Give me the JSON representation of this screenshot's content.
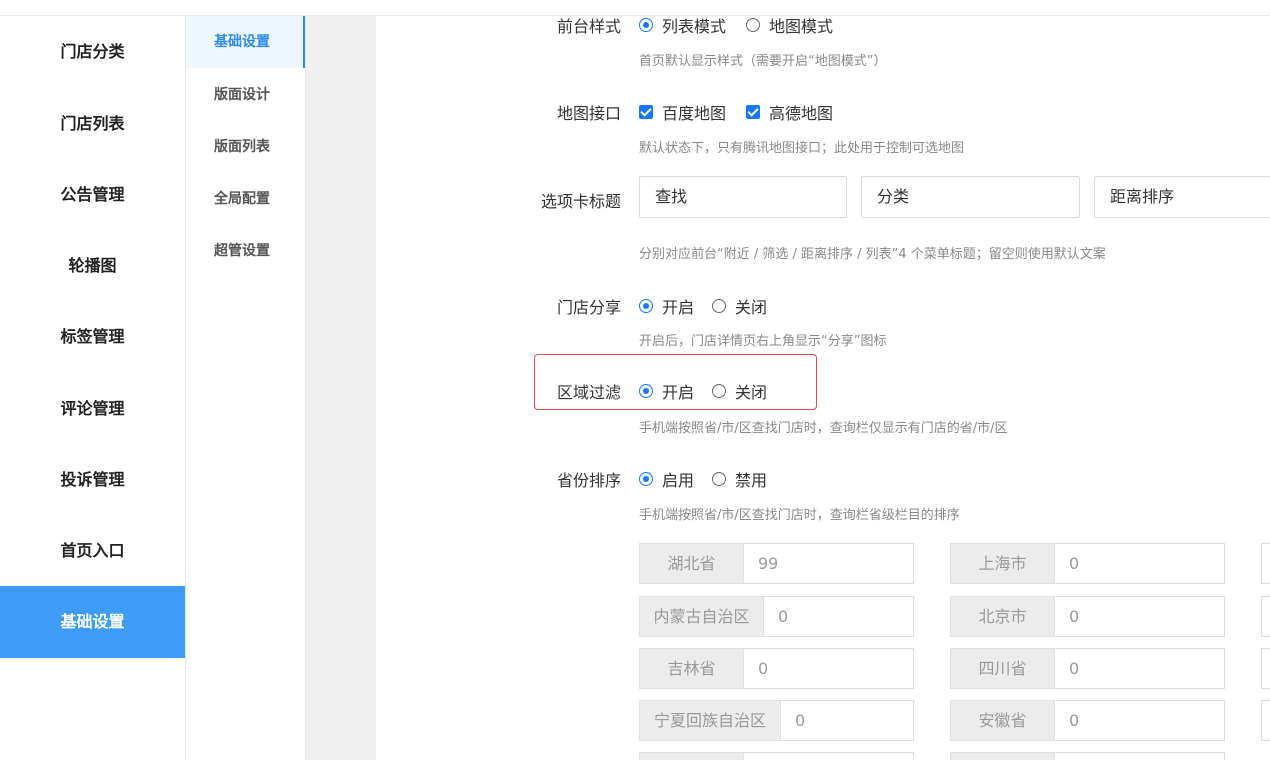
{
  "sidebar": {
    "items": [
      {
        "label": "门店分类"
      },
      {
        "label": "门店列表"
      },
      {
        "label": "公告管理"
      },
      {
        "label": "轮播图"
      },
      {
        "label": "标签管理"
      },
      {
        "label": "评论管理"
      },
      {
        "label": "投诉管理"
      },
      {
        "label": "首页入口"
      },
      {
        "label": "基础设置",
        "active": true
      }
    ],
    "active_color": "#3c9cf7"
  },
  "subnav": {
    "items": [
      {
        "label": "基础设置",
        "active": true
      },
      {
        "label": "版面设计"
      },
      {
        "label": "版面列表"
      },
      {
        "label": "全局配置"
      },
      {
        "label": "超管设置"
      }
    ]
  },
  "form": {
    "style": {
      "label": "前台样式",
      "options": [
        {
          "label": "列表模式",
          "checked": true
        },
        {
          "label": "地图模式",
          "checked": false
        }
      ],
      "hint": "首页默认显示样式（需要开启“地图模式”）"
    },
    "map": {
      "label": "地图接口",
      "options": [
        {
          "label": "百度地图",
          "checked": true
        },
        {
          "label": "高德地图",
          "checked": true
        }
      ],
      "hint": "默认状态下，只有腾讯地图接口；此处用于控制可选地图"
    },
    "tabs": {
      "label": "选项卡标题",
      "values": [
        "查找",
        "分类",
        "距离排序"
      ],
      "hint": "分别对应前台“附近 / 筛选 / 距离排序 / 列表”4 个菜单标题；留空则使用默认文案"
    },
    "share": {
      "label": "门店分享",
      "options": [
        {
          "label": "开启",
          "checked": true
        },
        {
          "label": "关闭",
          "checked": false
        }
      ],
      "hint": "开启后，门店详情页右上角显示“分享”图标"
    },
    "region_filter": {
      "label": "区域过滤",
      "options": [
        {
          "label": "开启",
          "checked": true
        },
        {
          "label": "关闭",
          "checked": false
        }
      ],
      "hint": "手机端按照省/市/区查找门店时，查询栏仅显示有门店的省/市/区",
      "highlight_color": "#e54d4d"
    },
    "province_sort": {
      "label": "省份排序",
      "options": [
        {
          "label": "启用",
          "checked": true
        },
        {
          "label": "禁用",
          "checked": false
        }
      ],
      "hint": "手机端按照省/市/区查找门店时，查询栏省级栏目的排序",
      "provinces": [
        {
          "name": "湖北省",
          "value": "99"
        },
        {
          "name": "上海市",
          "value": "0"
        },
        {
          "name": "内蒙古自治区",
          "value": "0"
        },
        {
          "name": "北京市",
          "value": "0"
        },
        {
          "name": "吉林省",
          "value": "0"
        },
        {
          "name": "四川省",
          "value": "0"
        },
        {
          "name": "宁夏回族自治区",
          "value": "0"
        },
        {
          "name": "安徽省",
          "value": "0"
        }
      ]
    }
  },
  "accent_color": "#1677ff"
}
